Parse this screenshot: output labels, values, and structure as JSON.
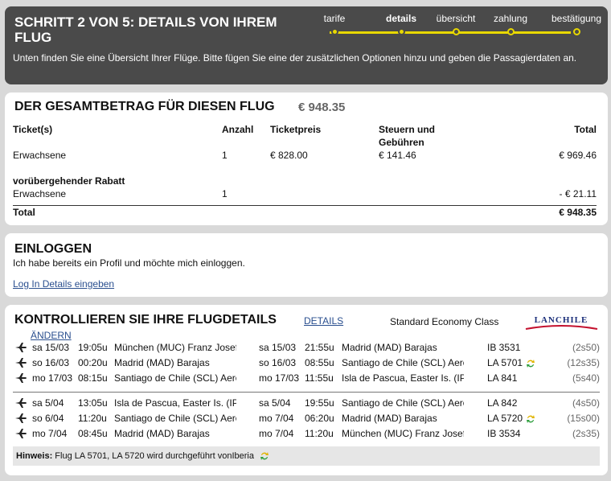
{
  "header": {
    "title": "SCHRITT 2 VON 5: DETAILS VON IHREM FLUG",
    "description": "Unten finden Sie eine Übersicht Ihrer Flüge. Bitte fügen Sie eine der zusätzlichen Optionen hinzu und geben die Passagierdaten an.",
    "steps": [
      "tarife",
      "details",
      "übersicht",
      "zahlung",
      "bestätigung"
    ],
    "active_step": "details",
    "accent_color": "#e8d800"
  },
  "total": {
    "title": "DER GESAMTBETRAG FÜR DIESEN FLUG",
    "amount": "€ 948.35",
    "columns": {
      "tickets": "Ticket(s)",
      "count": "Anzahl",
      "price": "Ticketpreis",
      "taxes_line1": "Steuern und",
      "taxes_line2": "Gebühren",
      "total": "Total"
    },
    "rows": [
      {
        "label": "Erwachsene",
        "count": "1",
        "price": "€ 828.00",
        "taxes": "€ 141.46",
        "total": "€ 969.46"
      }
    ],
    "discount_title": "vorübergehender Rabatt",
    "discount_row": {
      "label": "Erwachsene",
      "count": "1",
      "total": "- € 21.11"
    },
    "total_label": "Total",
    "total_value": "€ 948.35"
  },
  "login": {
    "title": "EINLOGGEN",
    "text": "Ich habe bereits ein Profil und möchte mich einloggen.",
    "link": "Log In Details eingeben"
  },
  "flights": {
    "title": "KONTROLLIEREN SIE IHRE FLUGDETAILS",
    "details_link": "DETAILS",
    "cabin": "Standard Economy Class",
    "airline_logo": "LANCHILE",
    "change_link": "ÄNDERN",
    "outbound": [
      {
        "dep_date": "sa 15/03",
        "dep_time": "19:05u",
        "dep_place": "München (MUC) Franz Josef Strauss",
        "arr_date": "sa 15/03",
        "arr_time": "21:55u",
        "arr_place": "Madrid (MAD) Barajas",
        "flight": "IB 3531",
        "codeshare": false,
        "duration": "(2s50)"
      },
      {
        "dep_date": "so 16/03",
        "dep_time": "00:20u",
        "dep_place": "Madrid (MAD) Barajas",
        "arr_date": "so 16/03",
        "arr_time": "08:55u",
        "arr_place": "Santiago de Chile (SCL) Aeropuerto",
        "flight": "LA 5701",
        "codeshare": true,
        "duration": "(12s35)"
      },
      {
        "dep_date": "mo 17/03",
        "dep_time": "08:15u",
        "dep_place": "Santiago de Chile (SCL) Aeropuerto",
        "arr_date": "mo 17/03",
        "arr_time": "11:55u",
        "arr_place": "Isla de Pascua, Easter Is. (IPC)",
        "flight": "LA 841",
        "codeshare": false,
        "duration": "(5s40)"
      }
    ],
    "return": [
      {
        "dep_date": "sa 5/04",
        "dep_time": "13:05u",
        "dep_place": "Isla de Pascua, Easter Is. (IPC)",
        "arr_date": "sa 5/04",
        "arr_time": "19:55u",
        "arr_place": "Santiago de Chile (SCL) Aeropuerto",
        "flight": "LA 842",
        "codeshare": false,
        "duration": "(4s50)"
      },
      {
        "dep_date": "so 6/04",
        "dep_time": "11:20u",
        "dep_place": "Santiago de Chile (SCL) Aeropuerto",
        "arr_date": "mo 7/04",
        "arr_time": "06:20u",
        "arr_place": "Madrid (MAD) Barajas",
        "flight": "LA 5720",
        "codeshare": true,
        "duration": "(15s00)"
      },
      {
        "dep_date": "mo 7/04",
        "dep_time": "08:45u",
        "dep_place": "Madrid (MAD) Barajas",
        "arr_date": "mo 7/04",
        "arr_time": "11:20u",
        "arr_place": "München (MUC) Franz Josef Strauss",
        "flight": "IB 3534",
        "codeshare": false,
        "duration": "(2s35)"
      }
    ],
    "note_label": "Hinweis:",
    "note_text": "Flug LA 5701, LA 5720 wird durchgeführt vonIberia"
  }
}
